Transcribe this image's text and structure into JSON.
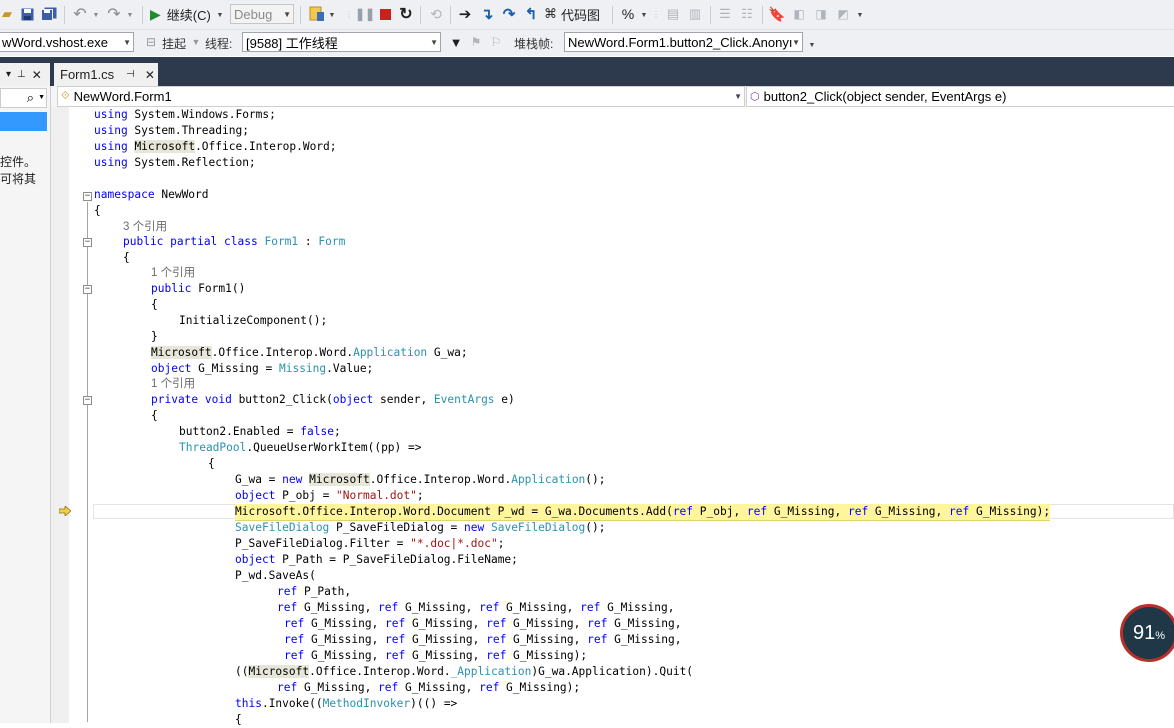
{
  "toolbar": {
    "continue_label": "继续(C)",
    "config_value": "Debug",
    "codemap_label": "代码图"
  },
  "debug_bar": {
    "process_value": "wWord.vshost.exe",
    "suspend_label": "挂起",
    "thread_label": "线程:",
    "thread_value": "[9588] 工作线程",
    "stackframe_label": "堆栈帧:",
    "stackframe_value": "NewWord.Form1.button2_Click.Anonyı"
  },
  "tabs": [
    {
      "label": "Form1.cs",
      "active": true
    }
  ],
  "left_panel": {
    "line1": "控件。",
    "line2": "可将其"
  },
  "navigation": {
    "class_value": "NewWord.Form1",
    "member_value": "button2_Click(object sender, EventArgs e)"
  },
  "code": {
    "ref3": "3 个引用",
    "ref1a": "1 个引用",
    "ref1b": "1 个引用"
  },
  "badge": {
    "value": "91",
    "unit": "%"
  },
  "colors": {
    "frame": "#2d3a4e",
    "keyword": "#0000ff",
    "type": "#2b91af",
    "string": "#a31515",
    "current_statement": "#fff59d",
    "badge_ring": "#b9302a"
  }
}
